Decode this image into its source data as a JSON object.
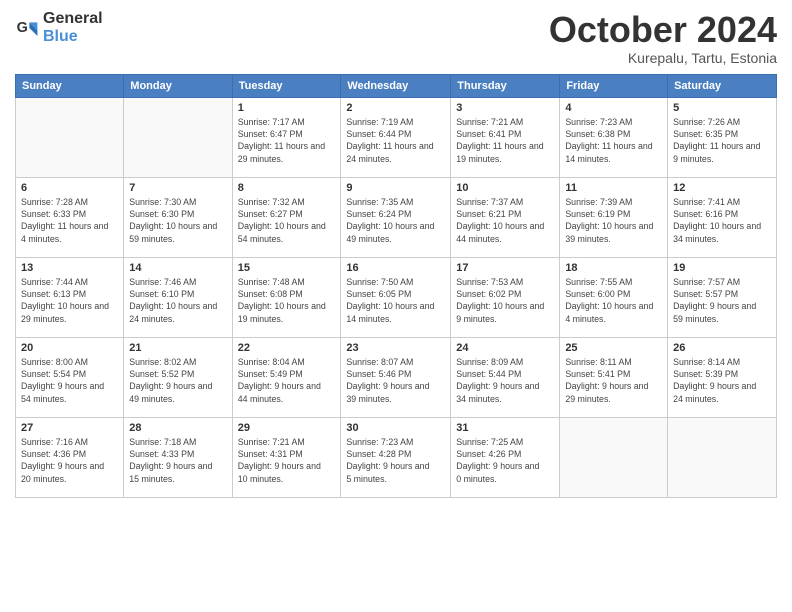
{
  "logo": {
    "general": "General",
    "blue": "Blue"
  },
  "header": {
    "month": "October 2024",
    "location": "Kurepalu, Tartu, Estonia"
  },
  "weekdays": [
    "Sunday",
    "Monday",
    "Tuesday",
    "Wednesday",
    "Thursday",
    "Friday",
    "Saturday"
  ],
  "weeks": [
    [
      {
        "day": "",
        "sunrise": "",
        "sunset": "",
        "daylight": ""
      },
      {
        "day": "",
        "sunrise": "",
        "sunset": "",
        "daylight": ""
      },
      {
        "day": "1",
        "sunrise": "Sunrise: 7:17 AM",
        "sunset": "Sunset: 6:47 PM",
        "daylight": "Daylight: 11 hours and 29 minutes."
      },
      {
        "day": "2",
        "sunrise": "Sunrise: 7:19 AM",
        "sunset": "Sunset: 6:44 PM",
        "daylight": "Daylight: 11 hours and 24 minutes."
      },
      {
        "day": "3",
        "sunrise": "Sunrise: 7:21 AM",
        "sunset": "Sunset: 6:41 PM",
        "daylight": "Daylight: 11 hours and 19 minutes."
      },
      {
        "day": "4",
        "sunrise": "Sunrise: 7:23 AM",
        "sunset": "Sunset: 6:38 PM",
        "daylight": "Daylight: 11 hours and 14 minutes."
      },
      {
        "day": "5",
        "sunrise": "Sunrise: 7:26 AM",
        "sunset": "Sunset: 6:35 PM",
        "daylight": "Daylight: 11 hours and 9 minutes."
      }
    ],
    [
      {
        "day": "6",
        "sunrise": "Sunrise: 7:28 AM",
        "sunset": "Sunset: 6:33 PM",
        "daylight": "Daylight: 11 hours and 4 minutes."
      },
      {
        "day": "7",
        "sunrise": "Sunrise: 7:30 AM",
        "sunset": "Sunset: 6:30 PM",
        "daylight": "Daylight: 10 hours and 59 minutes."
      },
      {
        "day": "8",
        "sunrise": "Sunrise: 7:32 AM",
        "sunset": "Sunset: 6:27 PM",
        "daylight": "Daylight: 10 hours and 54 minutes."
      },
      {
        "day": "9",
        "sunrise": "Sunrise: 7:35 AM",
        "sunset": "Sunset: 6:24 PM",
        "daylight": "Daylight: 10 hours and 49 minutes."
      },
      {
        "day": "10",
        "sunrise": "Sunrise: 7:37 AM",
        "sunset": "Sunset: 6:21 PM",
        "daylight": "Daylight: 10 hours and 44 minutes."
      },
      {
        "day": "11",
        "sunrise": "Sunrise: 7:39 AM",
        "sunset": "Sunset: 6:19 PM",
        "daylight": "Daylight: 10 hours and 39 minutes."
      },
      {
        "day": "12",
        "sunrise": "Sunrise: 7:41 AM",
        "sunset": "Sunset: 6:16 PM",
        "daylight": "Daylight: 10 hours and 34 minutes."
      }
    ],
    [
      {
        "day": "13",
        "sunrise": "Sunrise: 7:44 AM",
        "sunset": "Sunset: 6:13 PM",
        "daylight": "Daylight: 10 hours and 29 minutes."
      },
      {
        "day": "14",
        "sunrise": "Sunrise: 7:46 AM",
        "sunset": "Sunset: 6:10 PM",
        "daylight": "Daylight: 10 hours and 24 minutes."
      },
      {
        "day": "15",
        "sunrise": "Sunrise: 7:48 AM",
        "sunset": "Sunset: 6:08 PM",
        "daylight": "Daylight: 10 hours and 19 minutes."
      },
      {
        "day": "16",
        "sunrise": "Sunrise: 7:50 AM",
        "sunset": "Sunset: 6:05 PM",
        "daylight": "Daylight: 10 hours and 14 minutes."
      },
      {
        "day": "17",
        "sunrise": "Sunrise: 7:53 AM",
        "sunset": "Sunset: 6:02 PM",
        "daylight": "Daylight: 10 hours and 9 minutes."
      },
      {
        "day": "18",
        "sunrise": "Sunrise: 7:55 AM",
        "sunset": "Sunset: 6:00 PM",
        "daylight": "Daylight: 10 hours and 4 minutes."
      },
      {
        "day": "19",
        "sunrise": "Sunrise: 7:57 AM",
        "sunset": "Sunset: 5:57 PM",
        "daylight": "Daylight: 9 hours and 59 minutes."
      }
    ],
    [
      {
        "day": "20",
        "sunrise": "Sunrise: 8:00 AM",
        "sunset": "Sunset: 5:54 PM",
        "daylight": "Daylight: 9 hours and 54 minutes."
      },
      {
        "day": "21",
        "sunrise": "Sunrise: 8:02 AM",
        "sunset": "Sunset: 5:52 PM",
        "daylight": "Daylight: 9 hours and 49 minutes."
      },
      {
        "day": "22",
        "sunrise": "Sunrise: 8:04 AM",
        "sunset": "Sunset: 5:49 PM",
        "daylight": "Daylight: 9 hours and 44 minutes."
      },
      {
        "day": "23",
        "sunrise": "Sunrise: 8:07 AM",
        "sunset": "Sunset: 5:46 PM",
        "daylight": "Daylight: 9 hours and 39 minutes."
      },
      {
        "day": "24",
        "sunrise": "Sunrise: 8:09 AM",
        "sunset": "Sunset: 5:44 PM",
        "daylight": "Daylight: 9 hours and 34 minutes."
      },
      {
        "day": "25",
        "sunrise": "Sunrise: 8:11 AM",
        "sunset": "Sunset: 5:41 PM",
        "daylight": "Daylight: 9 hours and 29 minutes."
      },
      {
        "day": "26",
        "sunrise": "Sunrise: 8:14 AM",
        "sunset": "Sunset: 5:39 PM",
        "daylight": "Daylight: 9 hours and 24 minutes."
      }
    ],
    [
      {
        "day": "27",
        "sunrise": "Sunrise: 7:16 AM",
        "sunset": "Sunset: 4:36 PM",
        "daylight": "Daylight: 9 hours and 20 minutes."
      },
      {
        "day": "28",
        "sunrise": "Sunrise: 7:18 AM",
        "sunset": "Sunset: 4:33 PM",
        "daylight": "Daylight: 9 hours and 15 minutes."
      },
      {
        "day": "29",
        "sunrise": "Sunrise: 7:21 AM",
        "sunset": "Sunset: 4:31 PM",
        "daylight": "Daylight: 9 hours and 10 minutes."
      },
      {
        "day": "30",
        "sunrise": "Sunrise: 7:23 AM",
        "sunset": "Sunset: 4:28 PM",
        "daylight": "Daylight: 9 hours and 5 minutes."
      },
      {
        "day": "31",
        "sunrise": "Sunrise: 7:25 AM",
        "sunset": "Sunset: 4:26 PM",
        "daylight": "Daylight: 9 hours and 0 minutes."
      },
      {
        "day": "",
        "sunrise": "",
        "sunset": "",
        "daylight": ""
      },
      {
        "day": "",
        "sunrise": "",
        "sunset": "",
        "daylight": ""
      }
    ]
  ]
}
